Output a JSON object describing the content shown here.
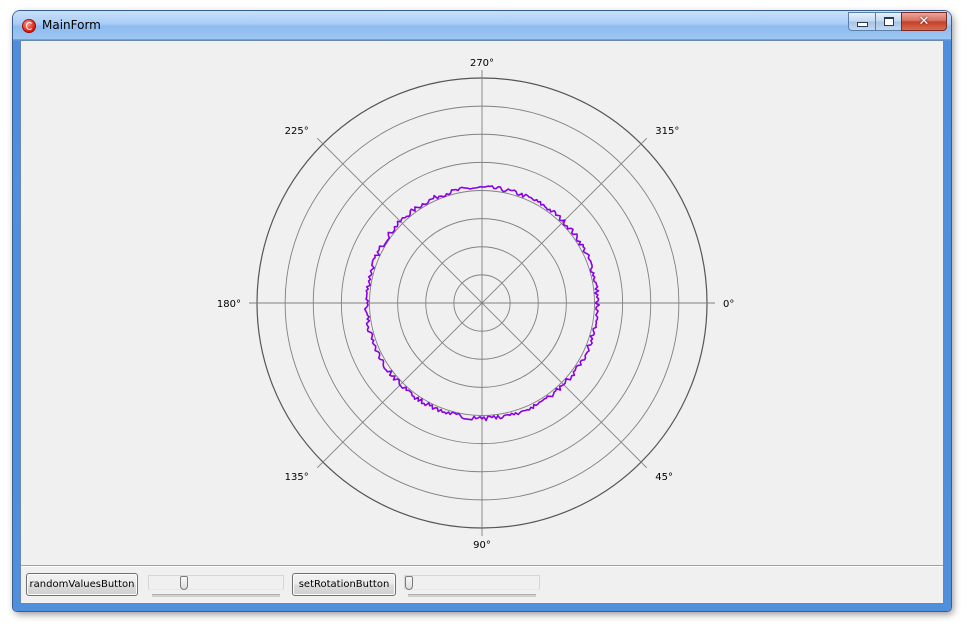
{
  "window": {
    "title": "MainForm",
    "icon": "app-red-circle-icon",
    "controls": {
      "minimize": "minimize-icon",
      "maximize": "maximize-icon",
      "close_label": "✕"
    }
  },
  "colors": {
    "trace": "#8a00e6",
    "grid": "#808080",
    "outer_ring": "#555555",
    "client_bg": "#f0f0f0"
  },
  "chart_data": {
    "type": "polar-line",
    "angle_labels": [
      "270°",
      "315°",
      "0°",
      "45°",
      "90°",
      "135°",
      "180°",
      "225°"
    ],
    "angle_values": [
      270,
      315,
      0,
      45,
      90,
      135,
      180,
      225
    ],
    "angle_direction": "clockwise",
    "zero_angle_position": "right",
    "ring_count": 8,
    "radial_range": [
      0,
      8
    ],
    "series": [
      {
        "mean_radius": 4.1,
        "noise_amplitude": 0.08,
        "point_count": 360
      }
    ]
  },
  "bottom": {
    "random_button_label": "randomValuesButton",
    "rotation_button_label": "setRotationButton",
    "random_slider_value": 0.25,
    "rotation_slider_value": 0.0
  }
}
